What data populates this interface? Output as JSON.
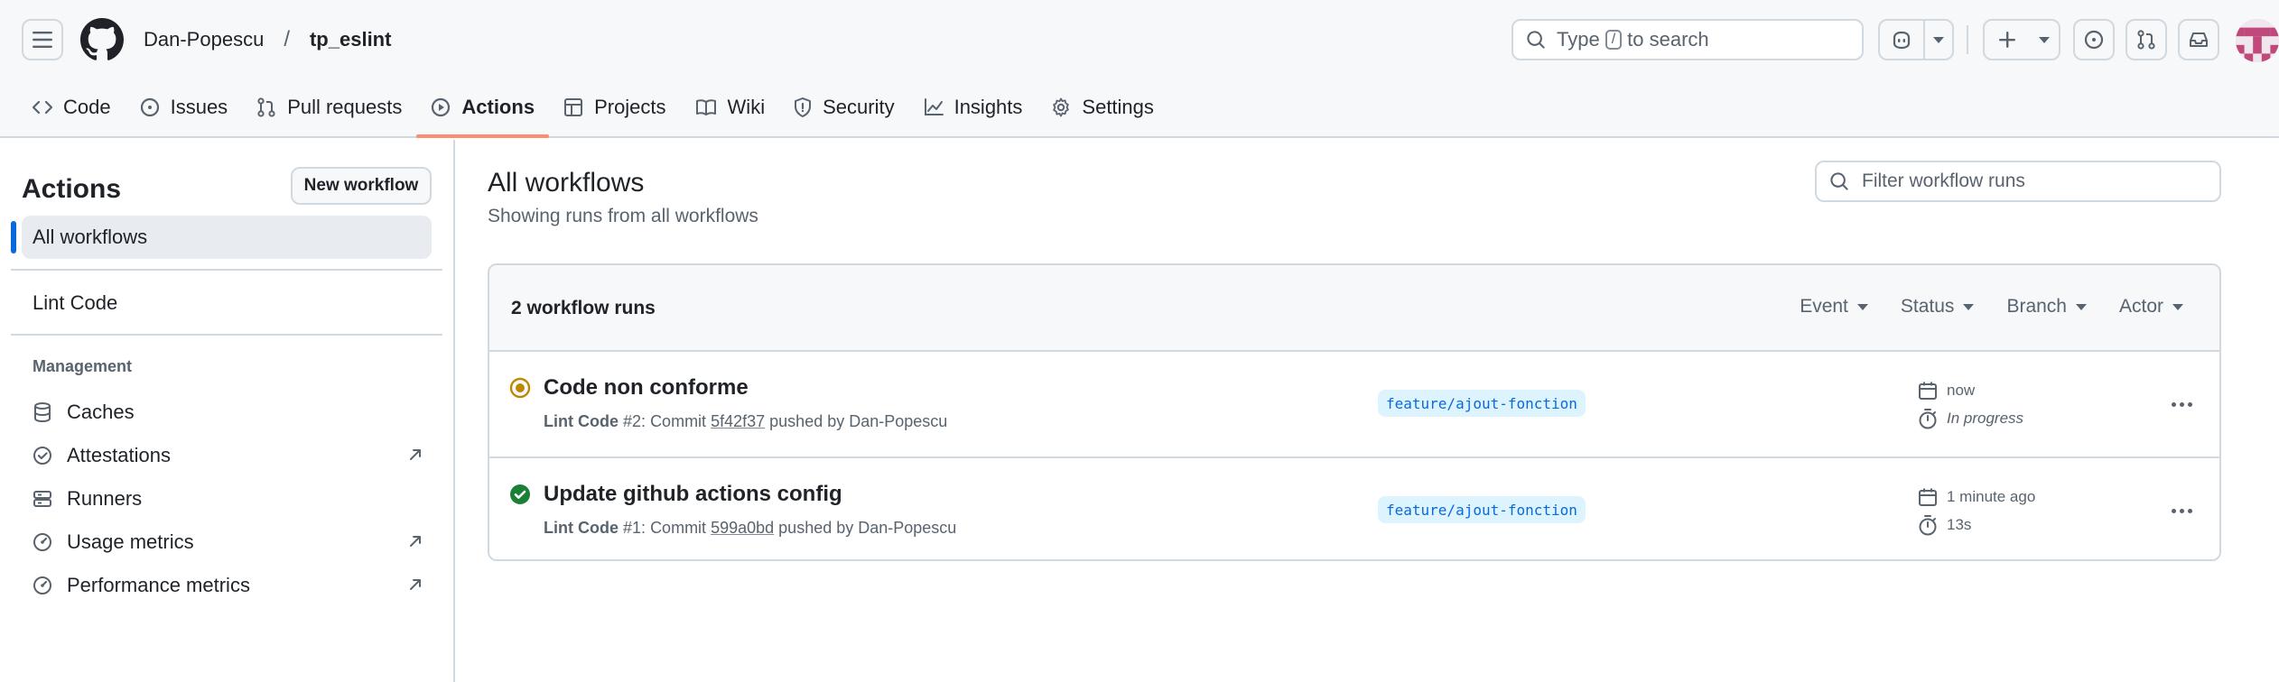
{
  "header": {
    "owner": "Dan-Popescu",
    "separator": "/",
    "repo": "tp_eslint",
    "search_prefix": "Type",
    "search_key": "/",
    "search_suffix": "to search"
  },
  "repo_nav": [
    {
      "label": "Code",
      "icon": "code-icon"
    },
    {
      "label": "Issues",
      "icon": "issue-icon"
    },
    {
      "label": "Pull requests",
      "icon": "pull-request-icon"
    },
    {
      "label": "Actions",
      "icon": "play-icon",
      "selected": true
    },
    {
      "label": "Projects",
      "icon": "table-icon"
    },
    {
      "label": "Wiki",
      "icon": "book-icon"
    },
    {
      "label": "Security",
      "icon": "shield-icon"
    },
    {
      "label": "Insights",
      "icon": "graph-icon"
    },
    {
      "label": "Settings",
      "icon": "gear-icon"
    }
  ],
  "sidebar": {
    "title": "Actions",
    "new_workflow": "New workflow",
    "all_workflows": "All workflows",
    "workflows": [
      "Lint Code"
    ],
    "management_label": "Management",
    "management": [
      {
        "label": "Caches",
        "icon": "database-icon",
        "external": false
      },
      {
        "label": "Attestations",
        "icon": "verified-icon",
        "external": true
      },
      {
        "label": "Runners",
        "icon": "server-icon",
        "external": false
      },
      {
        "label": "Usage metrics",
        "icon": "meter-icon",
        "external": true
      },
      {
        "label": "Performance metrics",
        "icon": "meter-icon",
        "external": true
      }
    ]
  },
  "main": {
    "title": "All workflows",
    "subtitle": "Showing runs from all workflows",
    "filter_placeholder": "Filter workflow runs",
    "runs_count": "2 workflow runs",
    "filters": [
      "Event",
      "Status",
      "Branch",
      "Actor"
    ],
    "runs": [
      {
        "status": "in-progress",
        "title": "Code non conforme",
        "workflow": "Lint Code",
        "run_number": "#2",
        "commit_label": "Commit",
        "commit": "5f42f37",
        "pushed_by": "pushed by Dan-Popescu",
        "branch": "feature/ajout-fonction",
        "when": "now",
        "duration": "In progress"
      },
      {
        "status": "success",
        "title": "Update github actions config",
        "workflow": "Lint Code",
        "run_number": "#1",
        "commit_label": "Commit",
        "commit": "599a0bd",
        "pushed_by": "pushed by Dan-Popescu",
        "branch": "feature/ajout-fonction",
        "when": "1 minute ago",
        "duration": "13s"
      }
    ]
  },
  "colors": {
    "accent": "#0969da",
    "tab_underline": "#fd8c73",
    "in_progress": "#bf8700",
    "success": "#1a7f37",
    "branch_bg": "#ddf4ff"
  }
}
